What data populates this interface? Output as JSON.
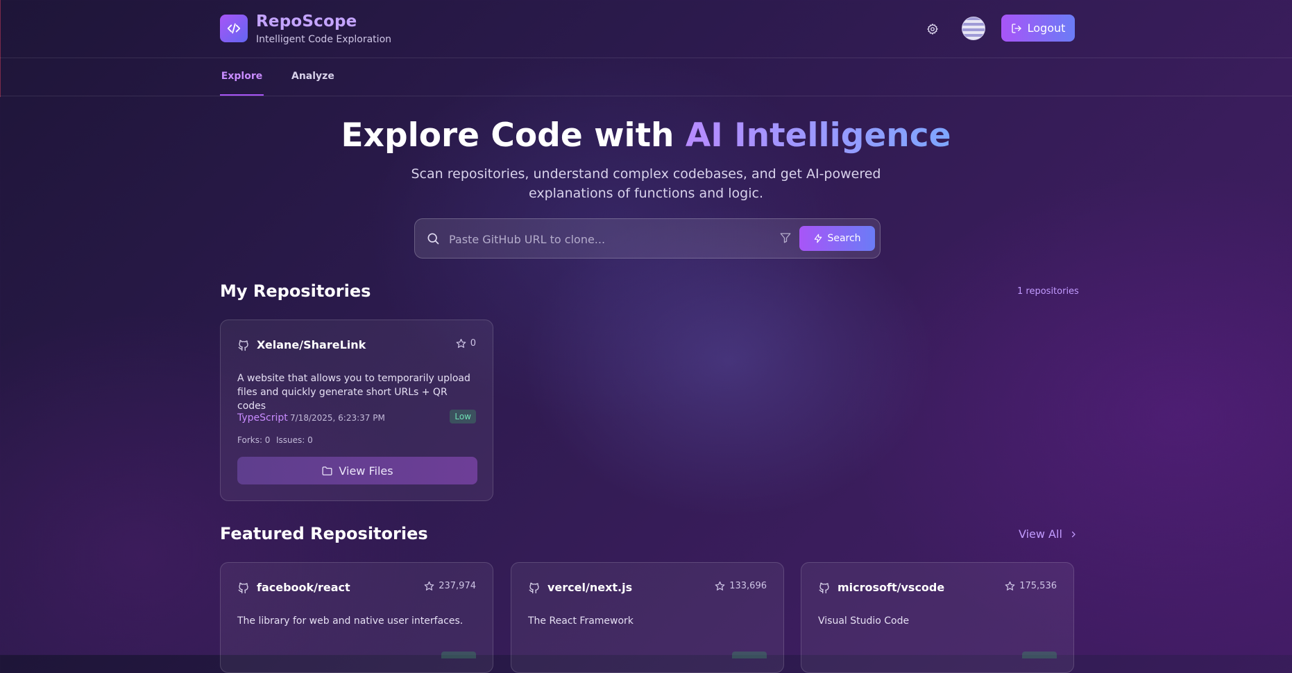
{
  "app": {
    "title": "RepoScope",
    "subtitle": "Intelligent Code Exploration"
  },
  "header": {
    "logout_label": "Logout"
  },
  "tabs": [
    {
      "label": "Explore",
      "active": true
    },
    {
      "label": "Analyze",
      "active": false
    }
  ],
  "hero": {
    "title_prefix": "Explore Code with ",
    "title_accent": "AI Intelligence",
    "subtitle": "Scan repositories, understand complex codebases, and get AI-powered explanations of functions and logic."
  },
  "search": {
    "placeholder": "Paste GitHub URL to clone...",
    "value": "",
    "button_label": "Search"
  },
  "my_repos": {
    "title": "My Repositories",
    "count_label": "1 repositories",
    "items": [
      {
        "name": "Xelane/ShareLink",
        "stars": "0",
        "description": "A website that allows you to temporarily upload files and quickly generate short URLs + QR codes",
        "language": "TypeScript",
        "date": "7/18/2025, 6:23:37 PM",
        "complexity": "Low",
        "forks": "Forks: 0",
        "issues": "Issues: 0",
        "action_label": "View Files"
      }
    ]
  },
  "featured": {
    "title": "Featured Repositories",
    "view_all_label": "View All",
    "items": [
      {
        "name": "facebook/react",
        "stars": "237,974",
        "description": "The library for web and native user interfaces."
      },
      {
        "name": "vercel/next.js",
        "stars": "133,696",
        "description": "The React Framework"
      },
      {
        "name": "microsoft/vscode",
        "stars": "175,536",
        "description": "Visual Studio Code"
      }
    ]
  },
  "colors": {
    "accent_purple": "#a855f7",
    "accent_blue": "#6b7cf6",
    "background": "#2b1a4c",
    "low_badge": "#6fe0b4"
  }
}
